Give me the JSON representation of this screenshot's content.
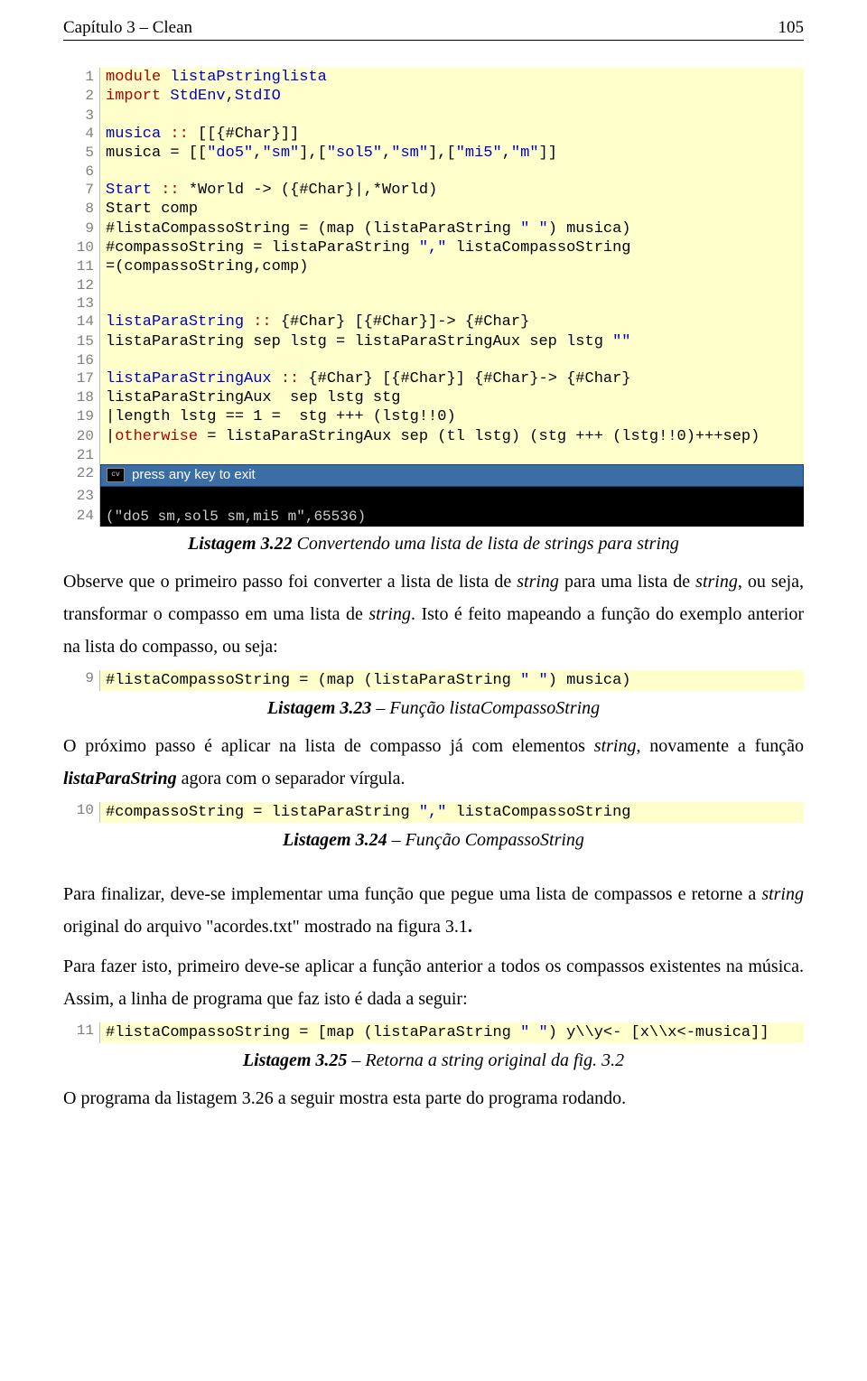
{
  "header": {
    "left": "Capítulo 3 – Clean",
    "right": "105"
  },
  "code1": {
    "lines": [
      {
        "n": "1",
        "html": "<span class='kw'>module</span> <span class='def'>listaPstringlista</span>"
      },
      {
        "n": "2",
        "html": "<span class='kw'>import</span> <span class='def'>StdEnv</span>,<span class='def'>StdIO</span>"
      },
      {
        "n": "3",
        "html": ""
      },
      {
        "n": "4",
        "html": "<span class='def'>musica</span> <span class='kw'>::</span> [[{#Char}]]"
      },
      {
        "n": "5",
        "html": "<span class='txt'>musica = [[</span><span class='def'>\"do5\"</span>,<span class='def'>\"sm\"</span>],[<span class='def'>\"sol5\"</span>,<span class='def'>\"sm\"</span>],[<span class='def'>\"mi5\"</span>,<span class='def'>\"m\"</span>]]"
      },
      {
        "n": "6",
        "html": ""
      },
      {
        "n": "7",
        "html": "<span class='def'>Start</span> <span class='kw'>::</span> *World -> ({#Char}|,*World)"
      },
      {
        "n": "8",
        "html": "<span class='txt'>Start comp</span>"
      },
      {
        "n": "9",
        "html": "#listaCompassoString = (map (listaParaString <span class='def'>\" \"</span>) musica)"
      },
      {
        "n": "10",
        "html": "#compassoString = listaParaString <span class='def'>\",\"</span> listaCompassoString"
      },
      {
        "n": "11",
        "html": "=(compassoString,comp)"
      },
      {
        "n": "12",
        "html": ""
      },
      {
        "n": "13",
        "html": ""
      },
      {
        "n": "14",
        "html": "<span class='def'>listaParaString</span> <span class='kw'>::</span> {#Char} [{#Char}]-> {#Char}"
      },
      {
        "n": "15",
        "html": "listaParaString sep lstg = listaParaStringAux sep lstg <span class='def'>\"\"</span>"
      },
      {
        "n": "16",
        "html": ""
      },
      {
        "n": "17",
        "html": "<span class='def'>listaParaStringAux</span> <span class='kw'>::</span> {#Char} [{#Char}] {#Char}-> {#Char}"
      },
      {
        "n": "18",
        "html": "listaParaStringAux  sep lstg stg"
      },
      {
        "n": "19",
        "html": "|length lstg == 1 =  stg +++ (lstg!!0)"
      },
      {
        "n": "20",
        "html": "|<span class='kw'>otherwise</span> = listaParaStringAux sep (tl lstg) (stg +++ (lstg!!0)+++sep)"
      },
      {
        "n": "21",
        "html": ""
      },
      {
        "n": "22",
        "html": ""
      },
      {
        "n": "23",
        "html": ""
      },
      {
        "n": "24",
        "html": ""
      }
    ]
  },
  "console": {
    "title": "press any key to exit",
    "output": "(\"do5 sm,sol5 sm,mi5 m\",65536)"
  },
  "caption1": {
    "bold": "Listagem 3.22",
    "rest": " Convertendo uma lista de lista de strings para string"
  },
  "para1_a": "Observe que o primeiro passo foi converter a lista de lista de ",
  "para1_b": "string",
  "para1_c": " para uma lista de ",
  "para1_d": "string",
  "para1_e": ", ou seja, transformar o compasso em uma lista de ",
  "para1_f": "string",
  "para1_g": ". Isto é feito mapeando a função do exemplo anterior na lista do compasso, ou seja:",
  "snippet1": {
    "n": "9",
    "html": "#listaCompassoString = (map (listaParaString <span class='def'>\" \"</span>) musica)"
  },
  "caption2": {
    "bold": "Listagem 3.23",
    "rest": " – Função listaCompassoString"
  },
  "para2_a": "O próximo passo é aplicar na lista de compasso já com elementos ",
  "para2_b": "string",
  "para2_c": ", novamente a função ",
  "para2_d": "listaParaString",
  "para2_e": " agora com o separador vírgula.",
  "snippet2": {
    "n": "10",
    "html": "#compassoString = listaParaString <span class='def'>\",\"</span> listaCompassoString"
  },
  "caption3": {
    "bold": "Listagem 3.24",
    "rest": " – Função CompassoString"
  },
  "para3_a": "Para finalizar, deve-se implementar uma função que pegue uma lista de compassos e retorne a ",
  "para3_b": "string",
  "para3_c": " original do arquivo \"acordes.txt\" mostrado na figura 3.1",
  "para3_d": ".",
  "para4": "Para fazer isto, primeiro deve-se aplicar a função anterior a todos os compassos existentes na música. Assim, a linha de programa que faz isto é dada a seguir:",
  "snippet3": {
    "n": "11",
    "html": "#listaCompassoString = [map (listaParaString <span class='def'>\" \"</span>) y\\\\y<- [x\\\\x<-musica]]"
  },
  "caption4": {
    "bold": "Listagem 3.25",
    "rest": " – Retorna a string original da fig. 3.2"
  },
  "para5": "O programa da listagem 3.26 a seguir mostra esta parte do programa rodando."
}
